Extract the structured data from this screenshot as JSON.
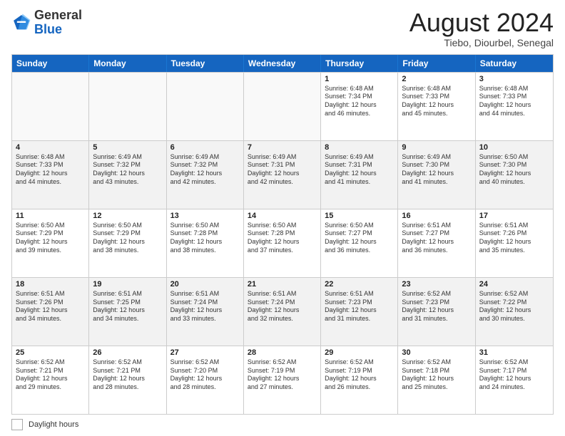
{
  "logo": {
    "general": "General",
    "blue": "Blue"
  },
  "header": {
    "month": "August 2024",
    "location": "Tiebo, Diourbel, Senegal"
  },
  "days_of_week": [
    "Sunday",
    "Monday",
    "Tuesday",
    "Wednesday",
    "Thursday",
    "Friday",
    "Saturday"
  ],
  "weeks": [
    [
      {
        "day": "",
        "info": ""
      },
      {
        "day": "",
        "info": ""
      },
      {
        "day": "",
        "info": ""
      },
      {
        "day": "",
        "info": ""
      },
      {
        "day": "1",
        "info": "Sunrise: 6:48 AM\nSunset: 7:34 PM\nDaylight: 12 hours\nand 46 minutes."
      },
      {
        "day": "2",
        "info": "Sunrise: 6:48 AM\nSunset: 7:33 PM\nDaylight: 12 hours\nand 45 minutes."
      },
      {
        "day": "3",
        "info": "Sunrise: 6:48 AM\nSunset: 7:33 PM\nDaylight: 12 hours\nand 44 minutes."
      }
    ],
    [
      {
        "day": "4",
        "info": "Sunrise: 6:48 AM\nSunset: 7:33 PM\nDaylight: 12 hours\nand 44 minutes."
      },
      {
        "day": "5",
        "info": "Sunrise: 6:49 AM\nSunset: 7:32 PM\nDaylight: 12 hours\nand 43 minutes."
      },
      {
        "day": "6",
        "info": "Sunrise: 6:49 AM\nSunset: 7:32 PM\nDaylight: 12 hours\nand 42 minutes."
      },
      {
        "day": "7",
        "info": "Sunrise: 6:49 AM\nSunset: 7:31 PM\nDaylight: 12 hours\nand 42 minutes."
      },
      {
        "day": "8",
        "info": "Sunrise: 6:49 AM\nSunset: 7:31 PM\nDaylight: 12 hours\nand 41 minutes."
      },
      {
        "day": "9",
        "info": "Sunrise: 6:49 AM\nSunset: 7:30 PM\nDaylight: 12 hours\nand 41 minutes."
      },
      {
        "day": "10",
        "info": "Sunrise: 6:50 AM\nSunset: 7:30 PM\nDaylight: 12 hours\nand 40 minutes."
      }
    ],
    [
      {
        "day": "11",
        "info": "Sunrise: 6:50 AM\nSunset: 7:29 PM\nDaylight: 12 hours\nand 39 minutes."
      },
      {
        "day": "12",
        "info": "Sunrise: 6:50 AM\nSunset: 7:29 PM\nDaylight: 12 hours\nand 38 minutes."
      },
      {
        "day": "13",
        "info": "Sunrise: 6:50 AM\nSunset: 7:28 PM\nDaylight: 12 hours\nand 38 minutes."
      },
      {
        "day": "14",
        "info": "Sunrise: 6:50 AM\nSunset: 7:28 PM\nDaylight: 12 hours\nand 37 minutes."
      },
      {
        "day": "15",
        "info": "Sunrise: 6:50 AM\nSunset: 7:27 PM\nDaylight: 12 hours\nand 36 minutes."
      },
      {
        "day": "16",
        "info": "Sunrise: 6:51 AM\nSunset: 7:27 PM\nDaylight: 12 hours\nand 36 minutes."
      },
      {
        "day": "17",
        "info": "Sunrise: 6:51 AM\nSunset: 7:26 PM\nDaylight: 12 hours\nand 35 minutes."
      }
    ],
    [
      {
        "day": "18",
        "info": "Sunrise: 6:51 AM\nSunset: 7:26 PM\nDaylight: 12 hours\nand 34 minutes."
      },
      {
        "day": "19",
        "info": "Sunrise: 6:51 AM\nSunset: 7:25 PM\nDaylight: 12 hours\nand 34 minutes."
      },
      {
        "day": "20",
        "info": "Sunrise: 6:51 AM\nSunset: 7:24 PM\nDaylight: 12 hours\nand 33 minutes."
      },
      {
        "day": "21",
        "info": "Sunrise: 6:51 AM\nSunset: 7:24 PM\nDaylight: 12 hours\nand 32 minutes."
      },
      {
        "day": "22",
        "info": "Sunrise: 6:51 AM\nSunset: 7:23 PM\nDaylight: 12 hours\nand 31 minutes."
      },
      {
        "day": "23",
        "info": "Sunrise: 6:52 AM\nSunset: 7:23 PM\nDaylight: 12 hours\nand 31 minutes."
      },
      {
        "day": "24",
        "info": "Sunrise: 6:52 AM\nSunset: 7:22 PM\nDaylight: 12 hours\nand 30 minutes."
      }
    ],
    [
      {
        "day": "25",
        "info": "Sunrise: 6:52 AM\nSunset: 7:21 PM\nDaylight: 12 hours\nand 29 minutes."
      },
      {
        "day": "26",
        "info": "Sunrise: 6:52 AM\nSunset: 7:21 PM\nDaylight: 12 hours\nand 28 minutes."
      },
      {
        "day": "27",
        "info": "Sunrise: 6:52 AM\nSunset: 7:20 PM\nDaylight: 12 hours\nand 28 minutes."
      },
      {
        "day": "28",
        "info": "Sunrise: 6:52 AM\nSunset: 7:19 PM\nDaylight: 12 hours\nand 27 minutes."
      },
      {
        "day": "29",
        "info": "Sunrise: 6:52 AM\nSunset: 7:19 PM\nDaylight: 12 hours\nand 26 minutes."
      },
      {
        "day": "30",
        "info": "Sunrise: 6:52 AM\nSunset: 7:18 PM\nDaylight: 12 hours\nand 25 minutes."
      },
      {
        "day": "31",
        "info": "Sunrise: 6:52 AM\nSunset: 7:17 PM\nDaylight: 12 hours\nand 24 minutes."
      }
    ]
  ],
  "footer": {
    "label": "Daylight hours"
  }
}
